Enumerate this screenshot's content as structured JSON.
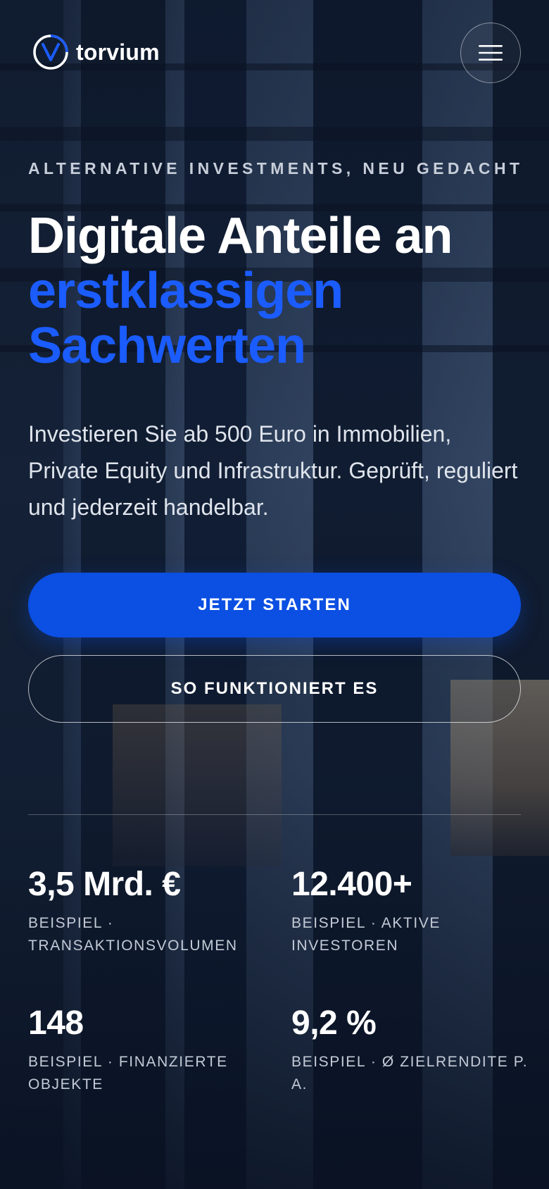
{
  "brand": {
    "name": "torvium",
    "accent": "#1b5cff"
  },
  "header": {
    "menu_icon": "hamburger-menu-icon"
  },
  "hero": {
    "eyebrow": "ALTERNATIVE INVESTMENTS, NEU GEDACHT",
    "headline_line1": "Digitale Anteile an",
    "headline_line2": "erstklassigen",
    "headline_line3": "Sachwerten",
    "lead": "Investieren Sie ab 500 Euro in Immobilien, Private Equity und Infrastruktur. Geprüft, reguliert und jederzeit handelbar.",
    "primary_cta": "JETZT STARTEN",
    "secondary_cta": "SO FUNKTIONIERT ES"
  },
  "stats": [
    {
      "value": "3,5 Mrd. €",
      "label": "BEISPIEL · TRANSAKTIONSVOLUMEN"
    },
    {
      "value": "12.400+",
      "label": "BEISPIEL · AKTIVE INVESTOREN"
    },
    {
      "value": "148",
      "label": "BEISPIEL · FINANZIERTE OBJEKTE"
    },
    {
      "value": "9,2 %",
      "label": "BEISPIEL · Ø ZIELRENDITE P. A."
    }
  ],
  "colors": {
    "primary_button": "#0b4fe3",
    "background": "#0b1526"
  }
}
